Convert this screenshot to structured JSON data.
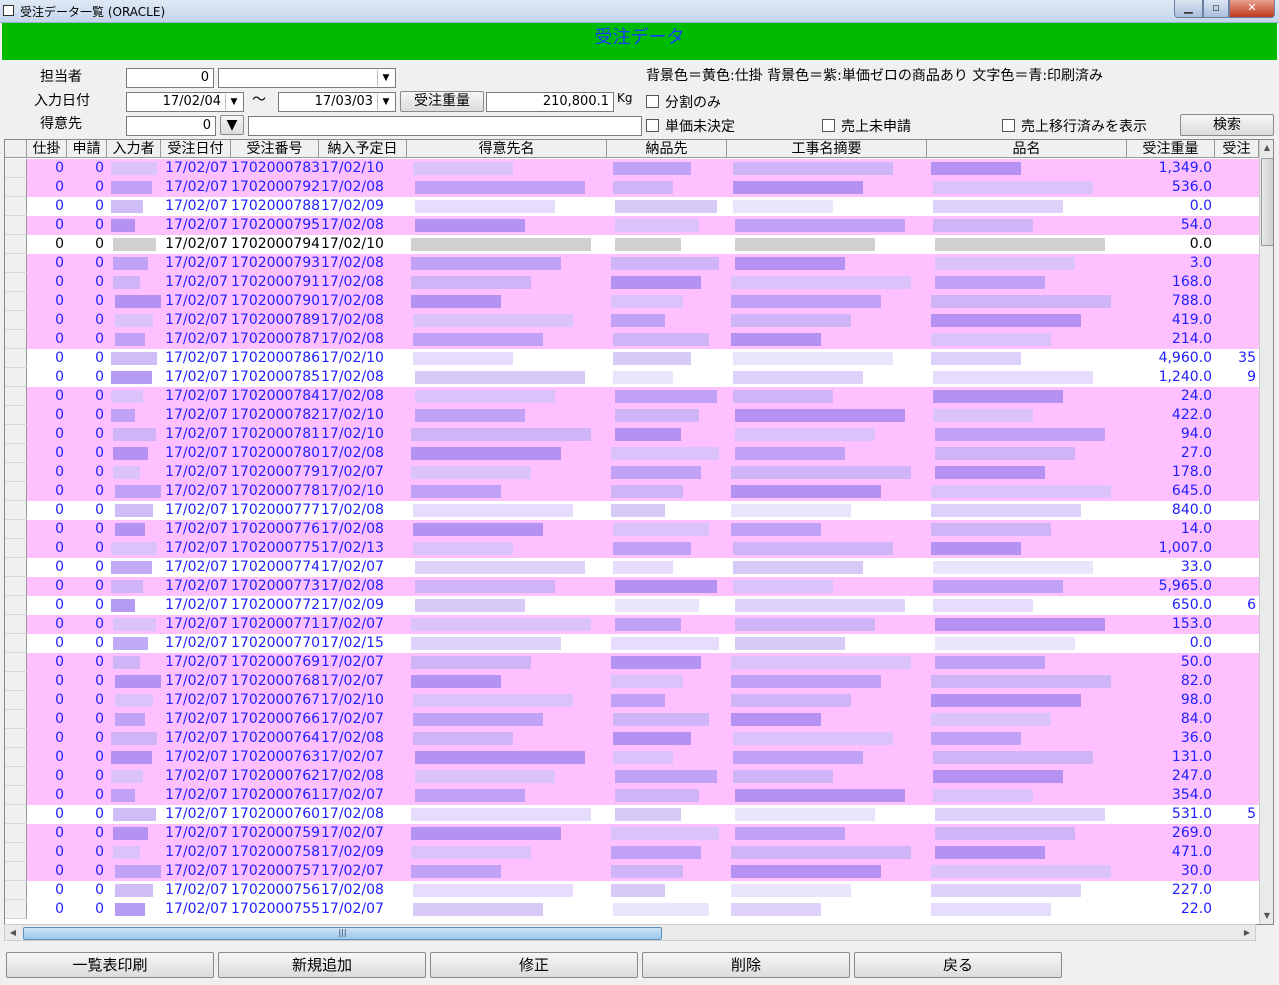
{
  "window": {
    "title": "受注データ一覧 (ORACLE)"
  },
  "banner": "受注データ",
  "legend": "背景色＝黄色:仕掛  背景色＝紫:単価ゼロの商品あり  文字色＝青:印刷済み",
  "filters": {
    "tanto_label": "担当者",
    "tanto_code": "0",
    "tanto_name": "",
    "date_label": "入力日付",
    "date_from": "17/02/04",
    "date_tilde": "〜",
    "date_to": "17/03/03",
    "weight_button": "受注重量",
    "weight_value": "210,800.1",
    "weight_unit": "Kg",
    "customer_label": "得意先",
    "customer_code": "0",
    "customer_name": "",
    "chk_split": "分割のみ",
    "chk_price": "単価未決定",
    "chk_uriage": "売上未申請",
    "chk_migrated": "売上移行済みを表示",
    "search_button": "検索"
  },
  "grid": {
    "headers": [
      "仕掛",
      "申請",
      "入力者",
      "受注日付",
      "受注番号",
      "納入予定日",
      "得意先名",
      "納品先",
      "工事名摘要",
      "品名",
      "受注重量",
      "受注"
    ],
    "rows": [
      {
        "s": "0",
        "a": "0",
        "d": "17/02/07",
        "no": "1702000783",
        "due": "17/02/10",
        "w": "1,349.0",
        "bg": "pink"
      },
      {
        "s": "0",
        "a": "0",
        "d": "17/02/07",
        "no": "1702000792",
        "due": "17/02/08",
        "w": "536.0",
        "bg": "pink"
      },
      {
        "s": "0",
        "a": "0",
        "d": "17/02/07",
        "no": "1702000788",
        "due": "17/02/09",
        "w": "0.0",
        "bg": "white"
      },
      {
        "s": "0",
        "a": "0",
        "d": "17/02/07",
        "no": "1702000795",
        "due": "17/02/08",
        "w": "54.0",
        "bg": "pink"
      },
      {
        "s": "0",
        "a": "0",
        "d": "17/02/07",
        "no": "1702000794",
        "due": "17/02/10",
        "w": "0.0",
        "bg": "grey"
      },
      {
        "s": "0",
        "a": "0",
        "d": "17/02/07",
        "no": "1702000793",
        "due": "17/02/08",
        "w": "3.0",
        "bg": "pink"
      },
      {
        "s": "0",
        "a": "0",
        "d": "17/02/07",
        "no": "1702000791",
        "due": "17/02/08",
        "w": "168.0",
        "bg": "pink"
      },
      {
        "s": "0",
        "a": "0",
        "d": "17/02/07",
        "no": "1702000790",
        "due": "17/02/08",
        "w": "788.0",
        "bg": "pink"
      },
      {
        "s": "0",
        "a": "0",
        "d": "17/02/07",
        "no": "1702000789",
        "due": "17/02/08",
        "w": "419.0",
        "bg": "pink"
      },
      {
        "s": "0",
        "a": "0",
        "d": "17/02/07",
        "no": "1702000787",
        "due": "17/02/08",
        "w": "214.0",
        "bg": "pink"
      },
      {
        "s": "0",
        "a": "0",
        "d": "17/02/07",
        "no": "1702000786",
        "due": "17/02/10",
        "w": "4,960.0",
        "bg": "white",
        "x": "35"
      },
      {
        "s": "0",
        "a": "0",
        "d": "17/02/07",
        "no": "1702000785",
        "due": "17/02/08",
        "w": "1,240.0",
        "bg": "white",
        "x": "9"
      },
      {
        "s": "0",
        "a": "0",
        "d": "17/02/07",
        "no": "1702000784",
        "due": "17/02/08",
        "w": "24.0",
        "bg": "pink"
      },
      {
        "s": "0",
        "a": "0",
        "d": "17/02/07",
        "no": "1702000782",
        "due": "17/02/10",
        "w": "422.0",
        "bg": "pink"
      },
      {
        "s": "0",
        "a": "0",
        "d": "17/02/07",
        "no": "1702000781",
        "due": "17/02/10",
        "w": "94.0",
        "bg": "pink"
      },
      {
        "s": "0",
        "a": "0",
        "d": "17/02/07",
        "no": "1702000780",
        "due": "17/02/08",
        "w": "27.0",
        "bg": "pink"
      },
      {
        "s": "0",
        "a": "0",
        "d": "17/02/07",
        "no": "1702000779",
        "due": "17/02/07",
        "w": "178.0",
        "bg": "pink"
      },
      {
        "s": "0",
        "a": "0",
        "d": "17/02/07",
        "no": "1702000778",
        "due": "17/02/10",
        "w": "645.0",
        "bg": "pink"
      },
      {
        "s": "0",
        "a": "0",
        "d": "17/02/07",
        "no": "1702000777",
        "due": "17/02/08",
        "w": "840.0",
        "bg": "white"
      },
      {
        "s": "0",
        "a": "0",
        "d": "17/02/07",
        "no": "1702000776",
        "due": "17/02/08",
        "w": "14.0",
        "bg": "pink"
      },
      {
        "s": "0",
        "a": "0",
        "d": "17/02/07",
        "no": "1702000775",
        "due": "17/02/13",
        "w": "1,007.0",
        "bg": "pink"
      },
      {
        "s": "0",
        "a": "0",
        "d": "17/02/07",
        "no": "1702000774",
        "due": "17/02/07",
        "w": "33.0",
        "bg": "white"
      },
      {
        "s": "0",
        "a": "0",
        "d": "17/02/07",
        "no": "1702000773",
        "due": "17/02/08",
        "w": "5,965.0",
        "bg": "pink"
      },
      {
        "s": "0",
        "a": "0",
        "d": "17/02/07",
        "no": "1702000772",
        "due": "17/02/09",
        "w": "650.0",
        "bg": "white",
        "x": "6"
      },
      {
        "s": "0",
        "a": "0",
        "d": "17/02/07",
        "no": "1702000771",
        "due": "17/02/07",
        "w": "153.0",
        "bg": "pink"
      },
      {
        "s": "0",
        "a": "0",
        "d": "17/02/07",
        "no": "1702000770",
        "due": "17/02/15",
        "w": "0.0",
        "bg": "white"
      },
      {
        "s": "0",
        "a": "0",
        "d": "17/02/07",
        "no": "1702000769",
        "due": "17/02/07",
        "w": "50.0",
        "bg": "pink"
      },
      {
        "s": "0",
        "a": "0",
        "d": "17/02/07",
        "no": "1702000768",
        "due": "17/02/07",
        "w": "82.0",
        "bg": "pink"
      },
      {
        "s": "0",
        "a": "0",
        "d": "17/02/07",
        "no": "1702000767",
        "due": "17/02/10",
        "w": "98.0",
        "bg": "pink"
      },
      {
        "s": "0",
        "a": "0",
        "d": "17/02/07",
        "no": "1702000766",
        "due": "17/02/07",
        "w": "84.0",
        "bg": "pink"
      },
      {
        "s": "0",
        "a": "0",
        "d": "17/02/07",
        "no": "1702000764",
        "due": "17/02/08",
        "w": "36.0",
        "bg": "pink"
      },
      {
        "s": "0",
        "a": "0",
        "d": "17/02/07",
        "no": "1702000763",
        "due": "17/02/07",
        "w": "131.0",
        "bg": "pink"
      },
      {
        "s": "0",
        "a": "0",
        "d": "17/02/07",
        "no": "1702000762",
        "due": "17/02/08",
        "w": "247.0",
        "bg": "pink"
      },
      {
        "s": "0",
        "a": "0",
        "d": "17/02/07",
        "no": "1702000761",
        "due": "17/02/07",
        "w": "354.0",
        "bg": "pink"
      },
      {
        "s": "0",
        "a": "0",
        "d": "17/02/07",
        "no": "1702000760",
        "due": "17/02/08",
        "w": "531.0",
        "bg": "white",
        "x": "5"
      },
      {
        "s": "0",
        "a": "0",
        "d": "17/02/07",
        "no": "1702000759",
        "due": "17/02/07",
        "w": "269.0",
        "bg": "pink"
      },
      {
        "s": "0",
        "a": "0",
        "d": "17/02/07",
        "no": "1702000758",
        "due": "17/02/09",
        "w": "471.0",
        "bg": "pink"
      },
      {
        "s": "0",
        "a": "0",
        "d": "17/02/07",
        "no": "1702000757",
        "due": "17/02/07",
        "w": "30.0",
        "bg": "pink"
      },
      {
        "s": "0",
        "a": "0",
        "d": "17/02/07",
        "no": "1702000756",
        "due": "17/02/08",
        "w": "227.0",
        "bg": "white"
      },
      {
        "s": "0",
        "a": "0",
        "d": "17/02/07",
        "no": "1702000755",
        "due": "17/02/07",
        "w": "22.0",
        "bg": "white"
      }
    ]
  },
  "colors": {
    "pink": "#ffc0ff",
    "text_blue": "#2020ff",
    "banner_green": "#00bb00"
  },
  "buttons": {
    "print": "一覧表印刷",
    "add": "新規追加",
    "edit": "修正",
    "delete": "削除",
    "back": "戻る"
  }
}
